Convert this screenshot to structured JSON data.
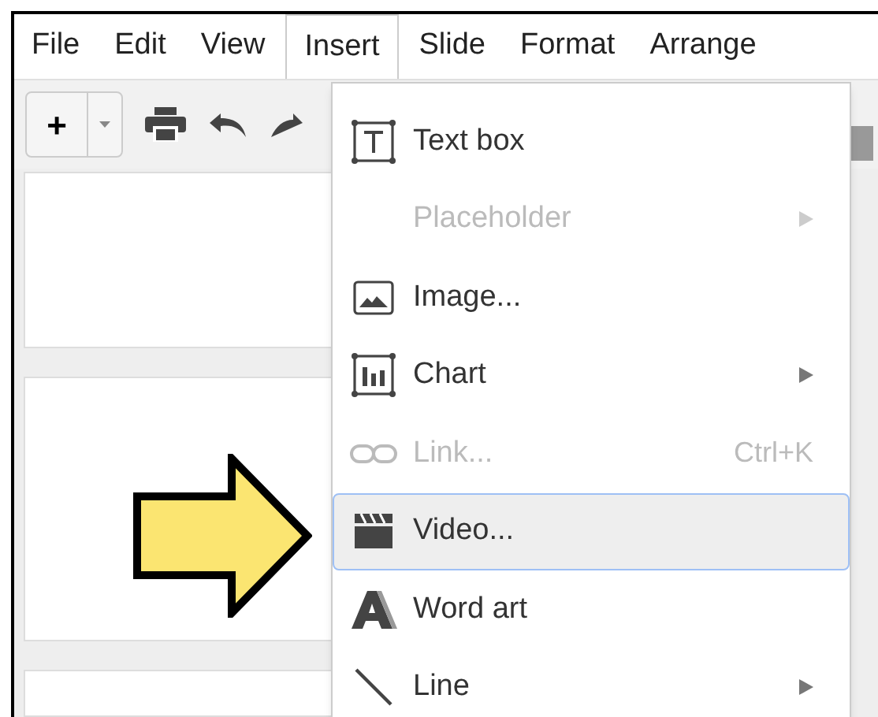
{
  "menu_bar": [
    {
      "label": "File",
      "selected": false
    },
    {
      "label": "Edit",
      "selected": false
    },
    {
      "label": "View",
      "selected": false
    },
    {
      "label": "Insert",
      "selected": true
    },
    {
      "label": "Slide",
      "selected": false
    },
    {
      "label": "Format",
      "selected": false
    },
    {
      "label": "Arrange",
      "selected": false
    }
  ],
  "toolbar": {
    "new_button": "+"
  },
  "insert_menu": [
    {
      "kind": "textbox",
      "label": "Text box",
      "disabled": false,
      "selected": false,
      "submenu": false
    },
    {
      "kind": "placeholder",
      "label": "Placeholder",
      "disabled": true,
      "selected": false,
      "submenu": true
    },
    {
      "kind": "image",
      "label": "Image...",
      "disabled": false,
      "selected": false,
      "submenu": false
    },
    {
      "kind": "chart",
      "label": "Chart",
      "disabled": false,
      "selected": false,
      "submenu": true
    },
    {
      "kind": "link",
      "label": "Link...",
      "disabled": true,
      "selected": false,
      "submenu": false,
      "shortcut": "Ctrl+K"
    },
    {
      "kind": "video",
      "label": "Video...",
      "disabled": false,
      "selected": true,
      "submenu": false
    },
    {
      "kind": "wordart",
      "label": "Word art",
      "disabled": false,
      "selected": false,
      "submenu": false
    },
    {
      "kind": "line",
      "label": "Line",
      "disabled": false,
      "selected": false,
      "submenu": true
    }
  ]
}
